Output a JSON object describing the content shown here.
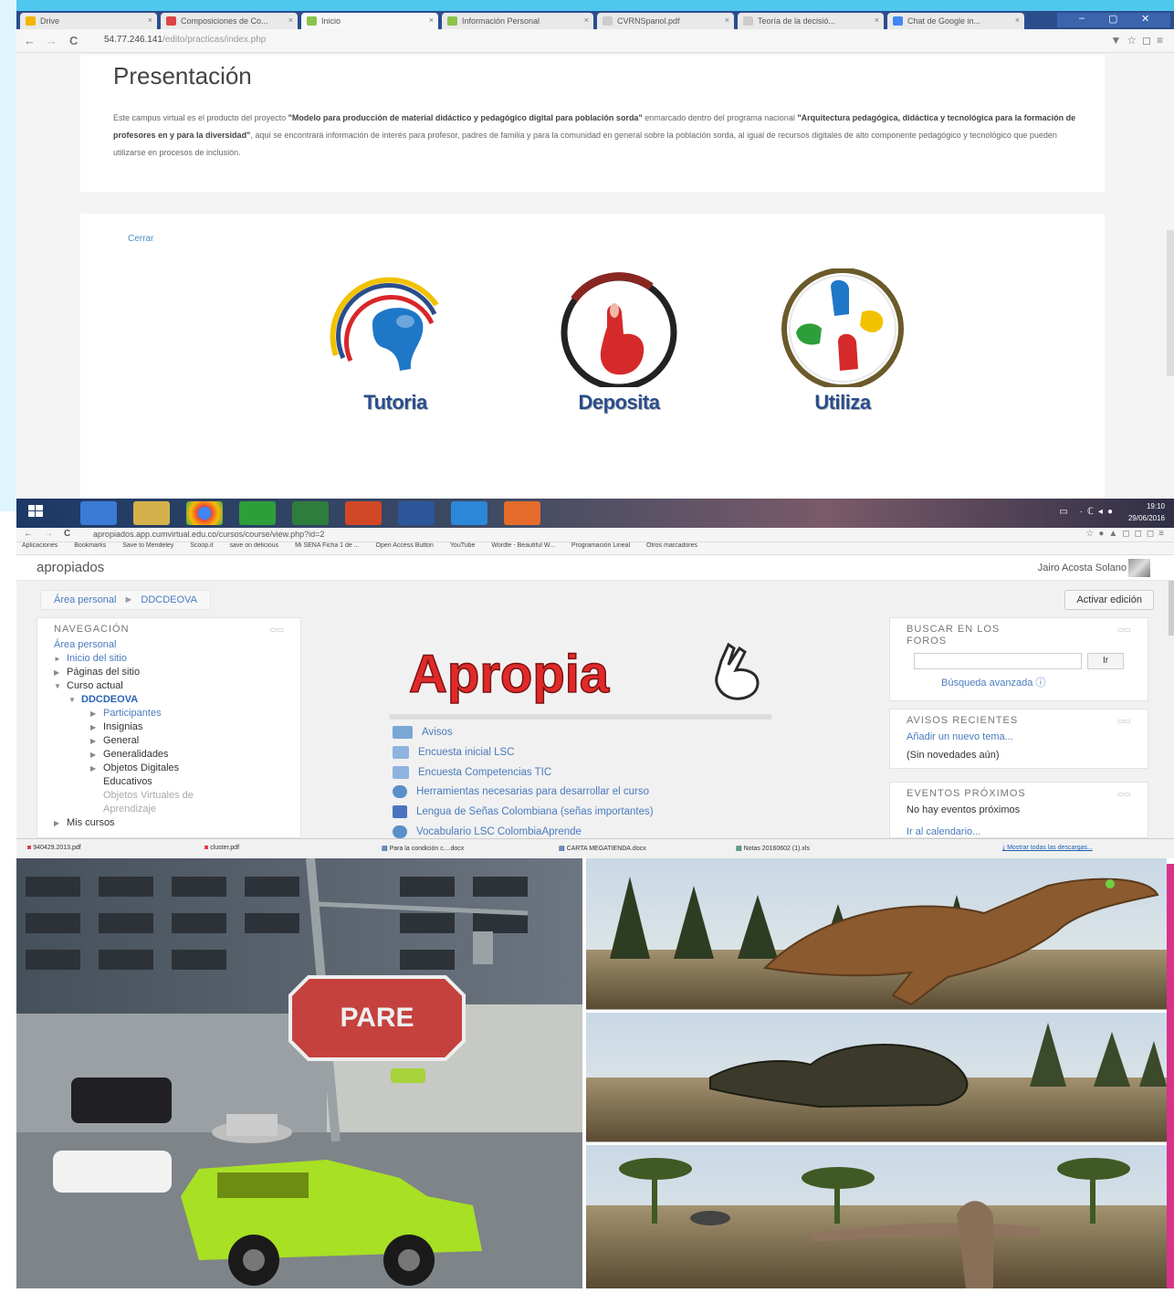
{
  "browser1": {
    "tabs": [
      {
        "label": "Drive"
      },
      {
        "label": "Composiciones de Co..."
      },
      {
        "label": "Inicio"
      },
      {
        "label": "Información Personal"
      },
      {
        "label": "CVRNSpanol.pdf"
      },
      {
        "label": "Teoría de la decisió..."
      },
      {
        "label": "Chat de Google in..."
      }
    ],
    "url_host": "54.77.246.141",
    "url_path": "/edito/practicas/index.php"
  },
  "presentation": {
    "title": "Presentación",
    "text_1": "Este campus virtual es el producto del proyecto ",
    "bold_1": "\"Modelo para producción de material didáctico y pedagógico digital para población sorda\"",
    "text_2": " enmarcado dentro del programa nacional ",
    "bold_2": "\"Arquitectura pedagógica, didáctica y tecnológica para la formación de profesores en y para la diversidad\"",
    "text_3": ", aquí se encontrará información de interés para profesor, padres de familia y para la comunidad en general sobre la población sorda, al igual de recursos digitales de alto componente pedagógico y tecnológico que pueden utilizarse en procesos de inclusión."
  },
  "logos_card": {
    "close_link": "Cerrar",
    "logos": [
      {
        "caption": "Tutoria"
      },
      {
        "caption": "Deposita"
      },
      {
        "caption": "Utiliza"
      }
    ]
  },
  "taskbar": {
    "time": "19:10",
    "date": "29/06/2016"
  },
  "browser2": {
    "url": "apropiados.app.cumvirtual.edu.co/cursos/course/view.php?id=2",
    "bookmarks": [
      "Aplicaciones",
      "Bookmarks",
      "Save to Mendeley",
      "Scoop.it",
      "save on delicious",
      "Mi SENA Ficha 1 de ...",
      "Open Access Button",
      "YouTube",
      "Wordle - Beautiful W...",
      "Programación Lineal",
      "Otros marcadores"
    ],
    "site_name": "apropiados",
    "user_name": "Jairo Acosta Solano",
    "breadcrumb": [
      "Área personal",
      "DDCDEOVA"
    ],
    "edit_button": "Activar edición",
    "nav_block": {
      "title": "NAVEGACIÓN",
      "items": [
        {
          "label": "Área personal"
        },
        {
          "label": "Inicio del sitio"
        },
        {
          "label": "Páginas del sitio"
        },
        {
          "label": "Curso actual"
        },
        {
          "label": "DDCDEOVA"
        },
        {
          "label": "Participantes"
        },
        {
          "label": "Insignias"
        },
        {
          "label": "General"
        },
        {
          "label": "Generalidades"
        },
        {
          "label": "Objetos Digitales"
        },
        {
          "label": "Educativos"
        },
        {
          "label": "Objetos Virtuales de"
        },
        {
          "label": "Aprendizaje"
        },
        {
          "label": "Mis cursos"
        }
      ]
    },
    "course_logo": "Apropia",
    "activities": [
      {
        "label": "Avisos"
      },
      {
        "label": "Encuesta inicial LSC"
      },
      {
        "label": "Encuesta Competencias TIC"
      },
      {
        "label": "Herramientas necesarias para desarrollar el curso"
      },
      {
        "label": "Lengua de Señas Colombiana (señas importantes)"
      },
      {
        "label": "Vocabulario LSC ColombiaAprende"
      }
    ],
    "search_block": {
      "title_1": "BUSCAR EN LOS",
      "title_2": "FOROS",
      "button": "Ir",
      "advanced": "Búsqueda avanzada"
    },
    "news_block": {
      "title": "AVISOS RECIENTES",
      "add_link": "Añadir un nuevo tema...",
      "empty": "(Sin novedades aún)"
    },
    "events_block": {
      "title": "EVENTOS PRÓXIMOS",
      "empty": "No hay eventos próximos",
      "calendar_link": "Ir al calendario..."
    }
  },
  "downloads": {
    "items": [
      {
        "label": "940429.2013.pdf"
      },
      {
        "label": "cluster.pdf"
      },
      {
        "label": "Para la condición c....docx"
      },
      {
        "label": "CARTA MEGATIENDA.docx"
      },
      {
        "label": "Notas 20160602 (1).xls"
      }
    ],
    "show_all": "Mostrar todas las descargas..."
  },
  "game": {
    "stop_sign": "PARE"
  }
}
